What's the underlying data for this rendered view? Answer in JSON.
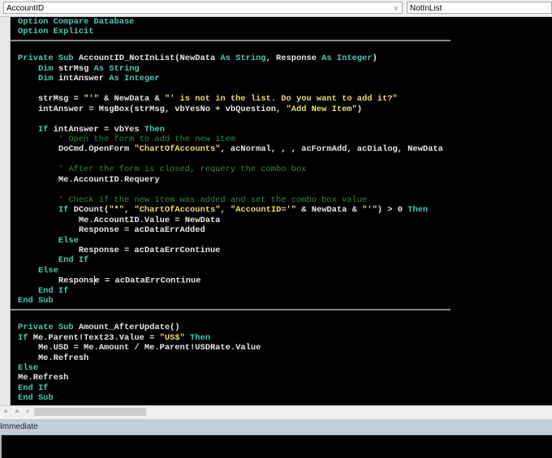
{
  "header": {
    "object_combo": "AccountID",
    "procedure_combo": "NotInList"
  },
  "colors": {
    "keyword": "#4ec9b0",
    "identifier": "#e6e6e6",
    "string": "#e6db74",
    "comment": "#2e8b3e",
    "background": "#000000"
  },
  "code": {
    "lines": [
      [
        [
          "k",
          "Option Compare Database"
        ]
      ],
      [
        [
          "k",
          "Option Explicit"
        ]
      ],
      "SEP",
      [],
      [
        [
          "k",
          "Private Sub "
        ],
        [
          "i",
          "AccountID_NotInList(NewData "
        ],
        [
          "k",
          "As String"
        ],
        [
          "i",
          ", Response "
        ],
        [
          "k",
          "As Integer"
        ],
        [
          "i",
          ")"
        ]
      ],
      [
        [
          "k",
          "    Dim "
        ],
        [
          "i",
          "strMsg "
        ],
        [
          "k",
          "As String"
        ]
      ],
      [
        [
          "k",
          "    Dim "
        ],
        [
          "i",
          "intAnswer "
        ],
        [
          "k",
          "As Integer"
        ]
      ],
      [],
      [
        [
          "i",
          "    strMsg = "
        ],
        [
          "s",
          "\"'\""
        ],
        [
          "i",
          " & NewData & "
        ],
        [
          "s",
          "\"' is not in the list. Do you want to add it?\""
        ]
      ],
      [
        [
          "i",
          "    intAnswer = MsgBox(strMsg, vbYesNo + vbQuestion, "
        ],
        [
          "s",
          "\"Add New Item\""
        ],
        [
          "i",
          ")"
        ]
      ],
      [],
      [
        [
          "k",
          "    If "
        ],
        [
          "i",
          "intAnswer = vbYes "
        ],
        [
          "k",
          "Then"
        ]
      ],
      [
        [
          "c",
          "        ' Open the form to add the new item"
        ]
      ],
      [
        [
          "i",
          "        DoCmd.OpenForm "
        ],
        [
          "s",
          "\"ChartOfAccounts\""
        ],
        [
          "i",
          ", acNormal, , , acFormAdd, acDialog, NewData"
        ]
      ],
      [],
      [
        [
          "c",
          "        ' After the form is closed, requery the combo box"
        ]
      ],
      [
        [
          "i",
          "        Me.AccountID.Requery"
        ]
      ],
      [],
      [
        [
          "c",
          "        ' Check if the new item was added and set the combo box value"
        ]
      ],
      [
        [
          "k",
          "        If "
        ],
        [
          "i",
          "DCount("
        ],
        [
          "s",
          "\"*\""
        ],
        [
          "i",
          ", "
        ],
        [
          "s",
          "\"ChartOfAccounts\""
        ],
        [
          "i",
          ", "
        ],
        [
          "s",
          "\"AccountID='\""
        ],
        [
          "i",
          " & NewData & "
        ],
        [
          "s",
          "\"'\""
        ],
        [
          "i",
          ") > 0 "
        ],
        [
          "k",
          "Then"
        ]
      ],
      [
        [
          "i",
          "            Me.AccountID.Value = NewData"
        ]
      ],
      [
        [
          "i",
          "            Response = acDataErrAdded"
        ]
      ],
      [
        [
          "k",
          "        Else"
        ]
      ],
      [
        [
          "i",
          "            Response = acDataErrContinue"
        ]
      ],
      [
        [
          "k",
          "        End If"
        ]
      ],
      [
        [
          "k",
          "    Else"
        ]
      ],
      [
        [
          "i",
          "        Respons"
        ],
        [
          "caret",
          ""
        ],
        [
          "i",
          "e = acDataErrContinue"
        ]
      ],
      [
        [
          "k",
          "    End If"
        ]
      ],
      [
        [
          "k",
          "End Sub"
        ]
      ],
      "SEP",
      [],
      [
        [
          "k",
          "Private Sub "
        ],
        [
          "i",
          "Amount_AfterUpdate()"
        ]
      ],
      [
        [
          "k",
          "If "
        ],
        [
          "i",
          "Me.Parent!Text23.Value = "
        ],
        [
          "s",
          "\"US$\""
        ],
        [
          "k",
          " Then"
        ]
      ],
      [
        [
          "i",
          "    Me.USD = Me.Amount / Me.Parent!USDRate.Value"
        ]
      ],
      [
        [
          "i",
          "    Me.Refresh"
        ]
      ],
      [
        [
          "k",
          "Else"
        ]
      ],
      [
        [
          "i",
          "Me.Refresh"
        ]
      ],
      [
        [
          "k",
          "End If"
        ]
      ],
      [
        [
          "k",
          "End Sub"
        ]
      ]
    ]
  },
  "immediate": {
    "title": "Immediate"
  }
}
